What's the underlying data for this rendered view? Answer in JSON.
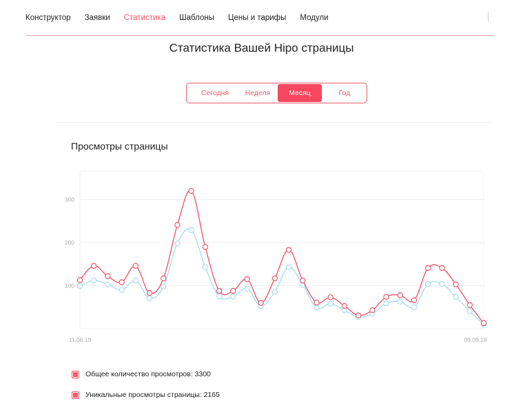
{
  "nav": {
    "items": [
      "Конструктор",
      "Заявки",
      "Статистика",
      "Шаблоны",
      "Цены и тарифы",
      "Модули"
    ],
    "active": "Статистика"
  },
  "page_title": "Статистика Вашей Hipo страницы",
  "period_tabs": {
    "items": [
      "Сегодня",
      "Неделя",
      "Месяц",
      "Год"
    ],
    "active": "Месяц"
  },
  "chart_title": "Просмотры страницы",
  "legend": {
    "total": "Общее количество просмотров: 3300",
    "unique": "Уникальные просмотры страницы: 2165"
  },
  "colors": {
    "accent": "#ef5a6a",
    "unique_line": "#a8ddf2"
  },
  "chart_data": {
    "type": "line",
    "x_start_label": "11.08.19",
    "x_end_label": "09.09.19",
    "yticks": [
      100,
      200,
      300
    ],
    "ylim": [
      0,
      370
    ],
    "grid": true,
    "series": [
      {
        "name": "Общее количество просмотров",
        "values": [
          113,
          146,
          122,
          108,
          146,
          83,
          117,
          241,
          320,
          190,
          88,
          88,
          115,
          60,
          117,
          183,
          112,
          61,
          73,
          53,
          31,
          43,
          74,
          78,
          66,
          141,
          141,
          103,
          55,
          13
        ]
      },
      {
        "name": "Уникальные просмотры страницы",
        "values": [
          99,
          112,
          103,
          90,
          112,
          71,
          98,
          198,
          229,
          143,
          75,
          75,
          93,
          53,
          86,
          143,
          102,
          49,
          58,
          43,
          27,
          35,
          59,
          63,
          50,
          104,
          104,
          74,
          41,
          10
        ]
      }
    ]
  }
}
